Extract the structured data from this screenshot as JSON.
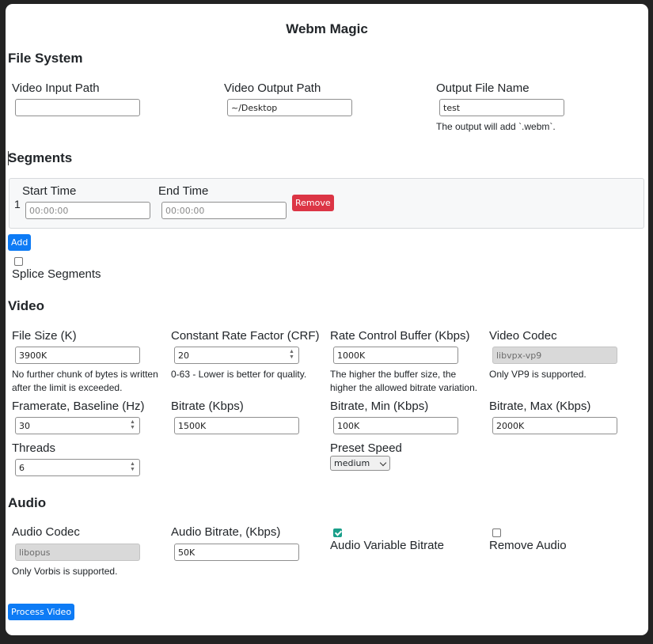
{
  "app": {
    "title": "Webm Magic"
  },
  "file_system": {
    "heading": "File System",
    "input_path": {
      "label": "Video Input Path",
      "value": ""
    },
    "output_path": {
      "label": "Video Output Path",
      "value": "~/Desktop"
    },
    "output_name": {
      "label": "Output File Name",
      "value": "test",
      "help": "The output will add `.webm`."
    }
  },
  "segments": {
    "heading": "Segments",
    "rows": [
      {
        "index": "1",
        "start_label": "Start Time",
        "start_placeholder": "00:00:00",
        "end_label": "End Time",
        "end_placeholder": "00:00:00",
        "remove_label": "Remove"
      }
    ],
    "add_label": "Add",
    "splice_label": "Splice Segments",
    "splice_checked": false
  },
  "video": {
    "heading": "Video",
    "file_size": {
      "label": "File Size (K)",
      "value": "3900K",
      "help": "No further chunk of bytes is written after the limit is exceeded."
    },
    "crf": {
      "label": "Constant Rate Factor (CRF)",
      "value": "20",
      "help": "0-63 - Lower is better for quality."
    },
    "rate_buffer": {
      "label": "Rate Control Buffer (Kbps)",
      "value": "1000K",
      "help": "The higher the buffer size, the higher the allowed bitrate variation."
    },
    "codec": {
      "label": "Video Codec",
      "value": "libvpx-vp9",
      "help": "Only VP9 is supported."
    },
    "framerate": {
      "label": "Framerate, Baseline (Hz)",
      "value": "30"
    },
    "bitrate": {
      "label": "Bitrate (Kbps)",
      "value": "1500K"
    },
    "bitrate_min": {
      "label": "Bitrate, Min (Kbps)",
      "value": "100K"
    },
    "bitrate_max": {
      "label": "Bitrate, Max (Kbps)",
      "value": "2000K"
    },
    "threads": {
      "label": "Threads",
      "value": "6"
    },
    "preset": {
      "label": "Preset Speed",
      "value": "medium"
    }
  },
  "audio": {
    "heading": "Audio",
    "codec": {
      "label": "Audio Codec",
      "value": "libopus",
      "help": "Only Vorbis is supported."
    },
    "bitrate": {
      "label": "Audio Bitrate, (Kbps)",
      "value": "50K"
    },
    "vbr": {
      "label": "Audio Variable Bitrate",
      "checked": true
    },
    "remove": {
      "label": "Remove Audio",
      "checked": false
    }
  },
  "actions": {
    "process_label": "Process Video"
  },
  "colors": {
    "primary": "#0d7bf5",
    "danger": "#dc3545",
    "checkbox_checked": "#1a9f8a",
    "window_bg": "#232323"
  }
}
